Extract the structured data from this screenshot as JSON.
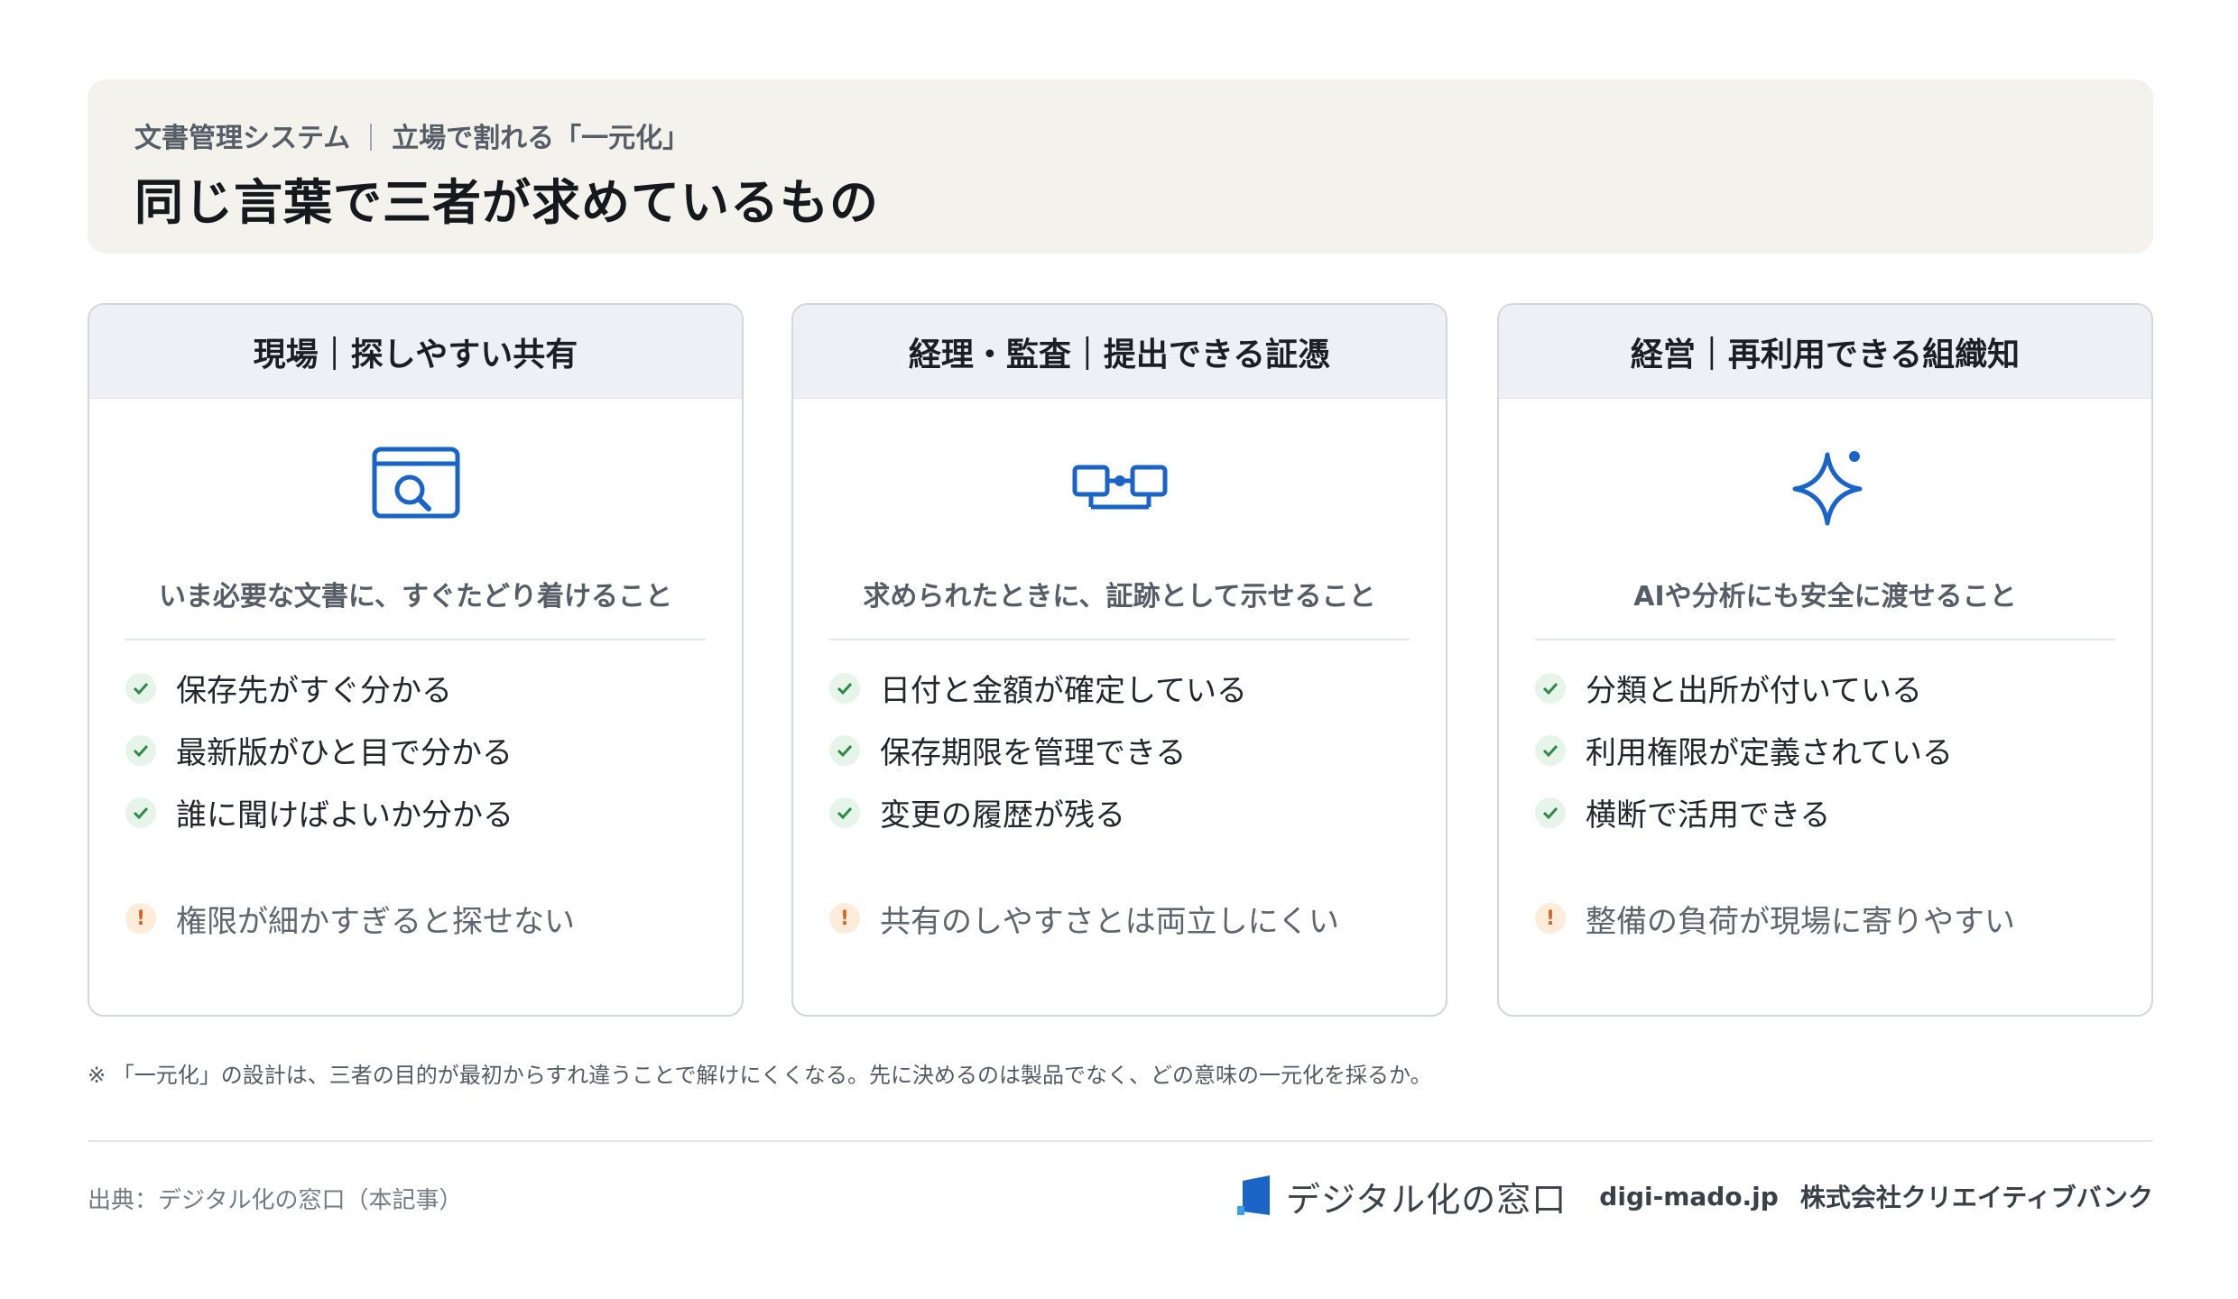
{
  "header": {
    "category": "文書管理システム",
    "topic": "立場で割れる「一元化」",
    "title": "同じ言葉で三者が求めているもの"
  },
  "colors": {
    "accent_blue": "#1a64c8",
    "check_green": "#2f8a48",
    "warning_orange": "#d4682a",
    "header_bg": "#f4f2ec",
    "card_head_bg": "#edf1f5"
  },
  "cards": [
    {
      "title": "現場｜探しやすい共有",
      "icon": "browser-search-icon",
      "lead": "いま必要な文書に、すぐたどり着けること",
      "checks": [
        "保存先がすぐ分かる",
        "最新版がひと目で分かる",
        "誰に聞けばよいか分かる"
      ],
      "warning": "権限が細かすぎると探せない"
    },
    {
      "title": "経理・監査｜提出できる証憑",
      "icon": "linked-documents-icon",
      "lead": "求められたときに、証跡として示せること",
      "checks": [
        "日付と金額が確定している",
        "保存期限を管理できる",
        "変更の履歴が残る"
      ],
      "warning": "共有のしやすさとは両立しにくい"
    },
    {
      "title": "経営｜再利用できる組織知",
      "icon": "sparkle-icon",
      "lead": "AIや分析にも安全に渡せること",
      "checks": [
        "分類と出所が付いている",
        "利用権限が定義されている",
        "横断で活用できる"
      ],
      "warning": "整備の負荷が現場に寄りやすい"
    }
  ],
  "note": "※ 「一元化」の設計は、三者の目的が最初からすれ違うことで解けにくくなる。先に決めるのは製品でなく、どの意味の一元化を採るか。",
  "footer": {
    "source": "出典：デジタル化の窓口（本記事）",
    "brand_name": "デジタル化の窓口",
    "domain": "digi-mado.jp",
    "company": "株式会社クリエイティブバンク"
  }
}
